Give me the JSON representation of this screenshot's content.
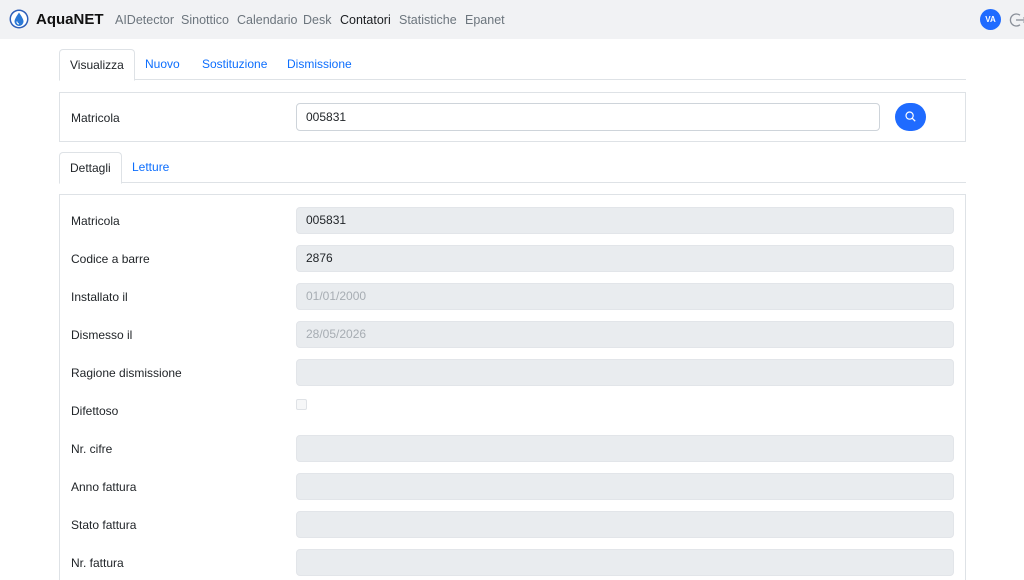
{
  "navbar": {
    "brand": "AquaNET",
    "items": [
      "AIDetector",
      "Sinottico",
      "Calendario",
      "Desk",
      "Contatori",
      "Statistiche",
      "Epanet"
    ],
    "active": "Contatori",
    "avatar_initials": "VA"
  },
  "tabs": [
    "Visualizza",
    "Nuovo",
    "Sostituzione",
    "Dismissione"
  ],
  "active_tab": "Visualizza",
  "search": {
    "label": "Matricola",
    "value": "005831"
  },
  "detail_tabs": [
    "Dettagli",
    "Letture"
  ],
  "active_detail_tab": "Dettagli",
  "details": {
    "matricola": {
      "label": "Matricola",
      "value": "005831"
    },
    "codice_barre": {
      "label": "Codice a barre",
      "value": "2876"
    },
    "installato": {
      "label": "Installato il",
      "value": "01/01/2000"
    },
    "dismesso": {
      "label": "Dismesso il",
      "value": "28/05/2026"
    },
    "ragione": {
      "label": "Ragione dismissione",
      "value": ""
    },
    "difettoso": {
      "label": "Difettoso",
      "checked": false
    },
    "nr_cifre": {
      "label": "Nr. cifre",
      "value": ""
    },
    "anno_fattura": {
      "label": "Anno fattura",
      "value": ""
    },
    "stato_fattura": {
      "label": "Stato fattura",
      "value": ""
    },
    "nr_fattura": {
      "label": "Nr. fattura",
      "value": ""
    }
  },
  "colors": {
    "accent": "#1f6bff",
    "link": "#0d6efd",
    "navbar_bg": "#f1f2f4",
    "field_bg": "#e9ecef"
  }
}
